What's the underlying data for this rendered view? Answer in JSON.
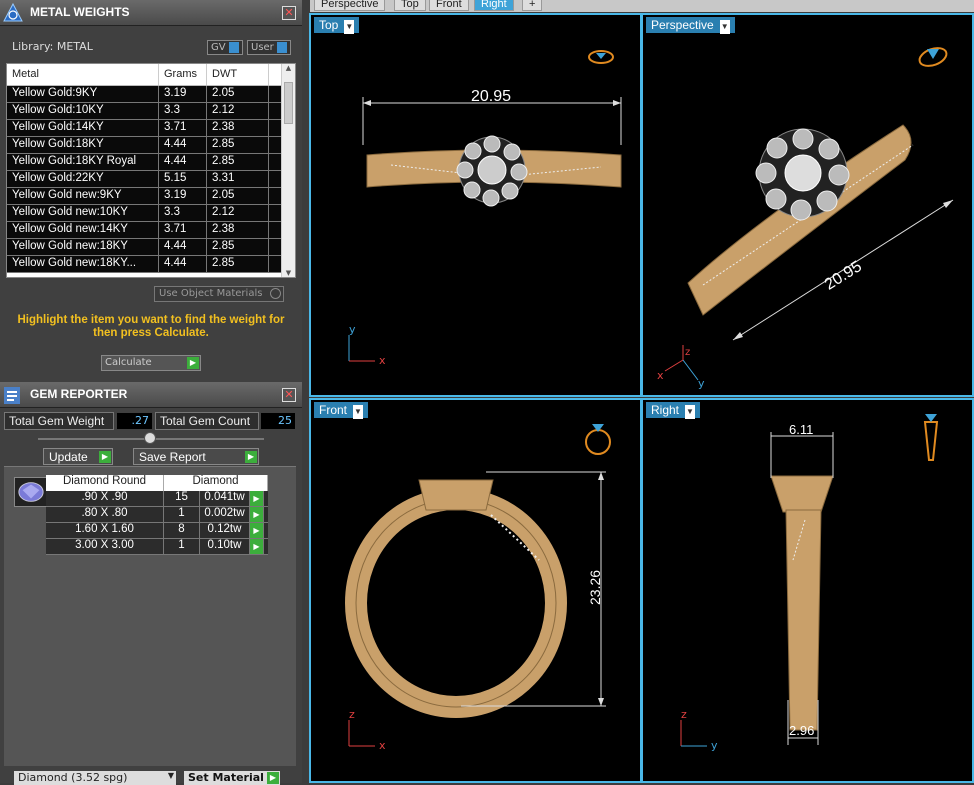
{
  "metal_weights": {
    "title": "METAL WEIGHTS",
    "library_label": "Library: METAL",
    "toggle_gv": "GV",
    "toggle_user": "User",
    "columns": [
      "Metal",
      "Grams",
      "DWT"
    ],
    "rows": [
      [
        "Yellow Gold:9KY",
        "3.19",
        "2.05"
      ],
      [
        "Yellow Gold:10KY",
        "3.3",
        "2.12"
      ],
      [
        "Yellow Gold:14KY",
        "3.71",
        "2.38"
      ],
      [
        "Yellow Gold:18KY",
        "4.44",
        "2.85"
      ],
      [
        "Yellow Gold:18KY Royal",
        "4.44",
        "2.85"
      ],
      [
        "Yellow Gold:22KY",
        "5.15",
        "3.31"
      ],
      [
        "Yellow Gold new:9KY",
        "3.19",
        "2.05"
      ],
      [
        "Yellow Gold new:10KY",
        "3.3",
        "2.12"
      ],
      [
        "Yellow Gold new:14KY",
        "3.71",
        "2.38"
      ],
      [
        "Yellow Gold new:18KY",
        "4.44",
        "2.85"
      ],
      [
        "Yellow Gold new:18KY...",
        "4.44",
        "2.85"
      ]
    ],
    "use_object_materials": "Use Object Materials",
    "hint": "Highlight the item you want to find the weight for then press Calculate.",
    "calculate": "Calculate"
  },
  "gem_reporter": {
    "title": "GEM REPORTER",
    "total_weight_label": "Total Gem Weight",
    "total_weight_value": ".27",
    "total_count_label": "Total Gem Count",
    "total_count_value": "25",
    "update": "Update",
    "save_report": "Save Report",
    "columns": [
      "Diamond Round",
      "Diamond"
    ],
    "rows": [
      [
        ".90 X .90",
        "15",
        "0.041tw"
      ],
      [
        ".80 X .80",
        "1",
        "0.002tw"
      ],
      [
        "1.60 X 1.60",
        "8",
        "0.12tw"
      ],
      [
        "3.00 X 3.00",
        "1",
        "0.10tw"
      ]
    ],
    "material_select": "Diamond    (3.52 spg)",
    "set_material": "Set Material"
  },
  "tabs": [
    "Perspective",
    "Top",
    "Front",
    "Right",
    "+"
  ],
  "active_tab": "Right",
  "viewports": {
    "top": {
      "label": "Top",
      "dimension": "20.95",
      "axes": [
        "y",
        "x"
      ]
    },
    "perspective": {
      "label": "Perspective",
      "dimension": "20.95",
      "axes": [
        "z",
        "x",
        "y"
      ]
    },
    "front": {
      "label": "Front",
      "dimension": "23.26",
      "axes": [
        "z",
        "x"
      ]
    },
    "right": {
      "label": "Right",
      "dimension_top": "6.11",
      "dimension_bottom": "2.96",
      "axes": [
        "z",
        "y"
      ]
    }
  },
  "colors": {
    "accent": "#3ea3d8",
    "gold": "#c9a06a",
    "hint": "#f2c020",
    "go": "#3cae3c"
  }
}
